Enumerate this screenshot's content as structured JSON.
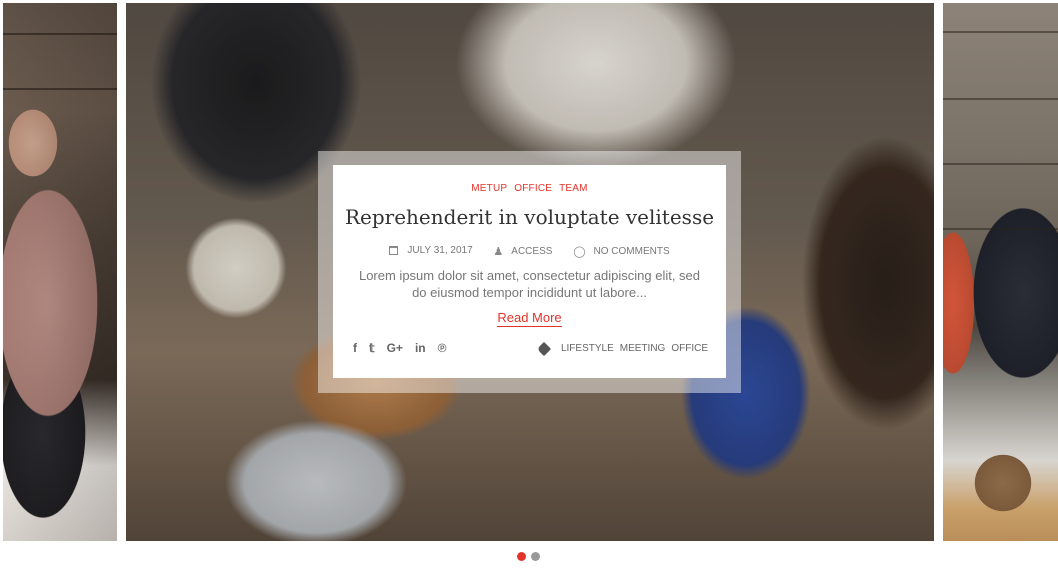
{
  "post": {
    "categories": [
      "METUP",
      "OFFICE",
      "TEAM"
    ],
    "title": "Reprehenderit in voluptate velitesse",
    "date": "JULY 31, 2017",
    "author": "ACCESS",
    "comments": "NO COMMENTS",
    "excerpt": "Lorem ipsum dolor sit amet, consectetur adipiscing elit, sed do eiusmod tempor incididunt ut labore...",
    "read_more": "Read More",
    "tags": [
      "LIFESTYLE",
      "MEETING",
      "OFFICE"
    ]
  },
  "social": [
    {
      "icon": "facebook-icon",
      "glyph": "f"
    },
    {
      "icon": "twitter-icon",
      "glyph": "𝕥"
    },
    {
      "icon": "google-plus-icon",
      "glyph": "G+"
    },
    {
      "icon": "linkedin-icon",
      "glyph": "in"
    },
    {
      "icon": "pinterest-icon",
      "glyph": "℗"
    }
  ],
  "slider": {
    "active_index": 0,
    "total": 2,
    "active_color": "#e5332a",
    "inactive_color": "#999999"
  },
  "colors": {
    "accent": "#e5332a",
    "title": "#333333",
    "text": "#777777"
  }
}
